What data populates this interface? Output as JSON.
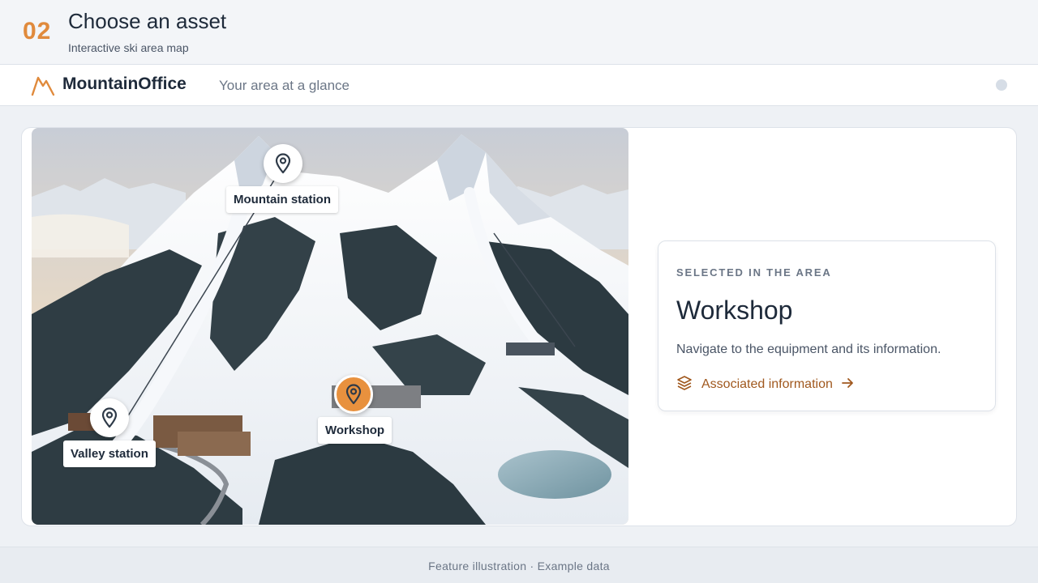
{
  "step": {
    "number": "02",
    "title": "Choose an asset",
    "subtitle": "Interactive ski area map"
  },
  "app": {
    "brand": "MountainOffice",
    "tagline": "Your area at a glance",
    "logo_icon": "mountain-icon"
  },
  "map": {
    "markers": [
      {
        "label": "Mountain station",
        "icon": "map-pin-icon",
        "selected": false
      },
      {
        "label": "Workshop",
        "icon": "map-pin-icon",
        "selected": true
      },
      {
        "label": "Valley station",
        "icon": "map-pin-icon",
        "selected": false
      }
    ]
  },
  "selection": {
    "eyebrow": "SELECTED IN THE AREA",
    "title": "Workshop",
    "description": "Navigate to the equipment and its information.",
    "link_label": "Associated information",
    "link_icon": "layers-icon",
    "link_arrow_icon": "arrow-right-icon"
  },
  "footer": {
    "text": "Feature illustration · Example data"
  },
  "colors": {
    "accent": "#e8913e",
    "accent_text": "#a0581e",
    "step_number": "#e08a3c",
    "text_primary": "#1e2a3a",
    "text_muted": "#6b7686"
  }
}
